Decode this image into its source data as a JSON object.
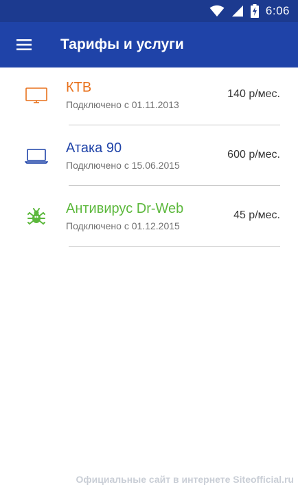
{
  "status_bar": {
    "time": "6:06",
    "icons": [
      "wifi-icon",
      "signal-icon",
      "battery-charging-icon"
    ]
  },
  "app_bar": {
    "menu_icon": "hamburger-menu-icon",
    "title": "Тарифы и услуги"
  },
  "services": [
    {
      "name": "КТВ",
      "connected": "Подключено с 01.11.2013",
      "price": "140 р/мес.",
      "icon": "tv-icon",
      "color": "#e8711c"
    },
    {
      "name": "Атака 90",
      "connected": "Подключено с 15.06.2015",
      "price": "600 р/мес.",
      "icon": "laptop-icon",
      "color": "#1f43a8"
    },
    {
      "name": "Антивирус Dr-Web",
      "connected": "Подключено с 01.12.2015",
      "price": "45 р/мес.",
      "icon": "spider-icon",
      "color": "#5cb83c"
    }
  ],
  "watermark": "Официальные сайт в интернете Siteofficial.ru"
}
